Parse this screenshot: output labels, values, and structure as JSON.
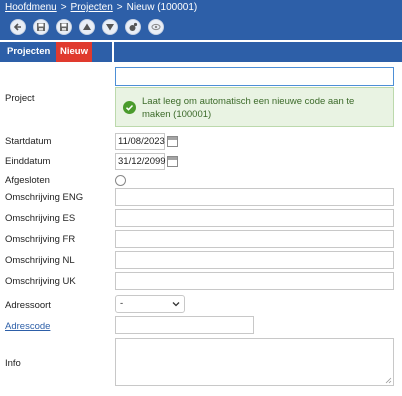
{
  "breadcrumb": {
    "items": [
      "Hoofdmenu",
      "Projecten",
      "Nieuw (100001)"
    ],
    "separator": ">"
  },
  "toolbar": {
    "buttons": [
      "back-icon",
      "save-icon",
      "save-new-icon",
      "up-icon",
      "down-icon",
      "copy-icon",
      "view-icon"
    ]
  },
  "tabs": {
    "active": "Projecten",
    "badge": "Nieuw"
  },
  "form": {
    "project": {
      "label": "Project",
      "value": "",
      "hint": "Laat leeg om automatisch een nieuwe code aan te maken (100001)"
    },
    "startdatum": {
      "label": "Startdatum",
      "value": "11/08/2023"
    },
    "einddatum": {
      "label": "Einddatum",
      "value": "31/12/2099"
    },
    "afgesloten": {
      "label": "Afgesloten",
      "checked": false
    },
    "omschrijving_eng": {
      "label": "Omschrijving ENG",
      "value": ""
    },
    "omschrijving_es": {
      "label": "Omschrijving ES",
      "value": ""
    },
    "omschrijving_fr": {
      "label": "Omschrijving FR",
      "value": ""
    },
    "omschrijving_nl": {
      "label": "Omschrijving NL",
      "value": ""
    },
    "omschrijving_uk": {
      "label": "Omschrijving UK",
      "value": ""
    },
    "adressoort": {
      "label": "Adressoort",
      "value": "-"
    },
    "adrescode": {
      "label": "Adrescode",
      "value": ""
    },
    "info": {
      "label": "Info",
      "value": ""
    }
  },
  "colors": {
    "header_blue": "#2d5fa8",
    "badge_red": "#e03a2e",
    "hint_bg": "#e9f3e3",
    "hint_text": "#3c6a2a",
    "focus_border": "#4d8fd6"
  }
}
